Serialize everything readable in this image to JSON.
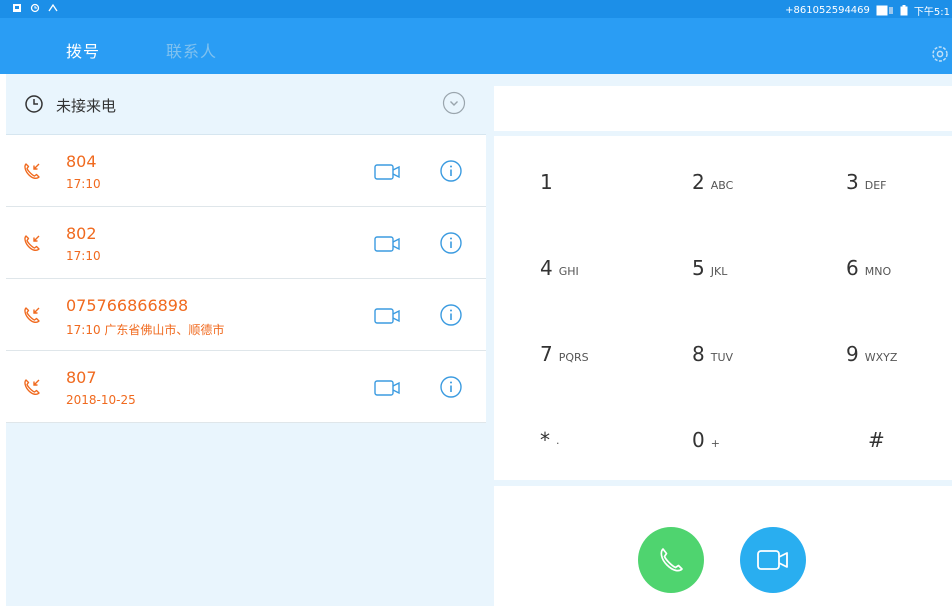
{
  "status_bar": {
    "phone_number": "+861052594469",
    "time": "下午5:1",
    "icons": [
      "sim-icon",
      "alarm-icon",
      "network-icon",
      "screen-icon",
      "battery-icon"
    ]
  },
  "tabs": {
    "dial": "拨号",
    "contacts": "联系人"
  },
  "call_log": {
    "section_title": "未接来电",
    "entries": [
      {
        "number": "804",
        "detail": "17:10"
      },
      {
        "number": "802",
        "detail": "17:10"
      },
      {
        "number": "075766866898",
        "detail": "17:10 广东省佛山市、顺德市"
      },
      {
        "number": "807",
        "detail": "2018-10-25"
      }
    ]
  },
  "dialpad": {
    "display_value": "",
    "keys": [
      {
        "digit": "1",
        "letters": ""
      },
      {
        "digit": "2",
        "letters": "ABC"
      },
      {
        "digit": "3",
        "letters": "DEF"
      },
      {
        "digit": "4",
        "letters": "GHI"
      },
      {
        "digit": "5",
        "letters": "JKL"
      },
      {
        "digit": "6",
        "letters": "MNO"
      },
      {
        "digit": "7",
        "letters": "PQRS"
      },
      {
        "digit": "8",
        "letters": "TUV"
      },
      {
        "digit": "9",
        "letters": "WXYZ"
      },
      {
        "digit": "*",
        "letters": "·"
      },
      {
        "digit": "0",
        "letters": "+"
      },
      {
        "digit": "#",
        "letters": ""
      }
    ]
  },
  "colors": {
    "status_bar": "#1c8fe8",
    "app_bar": "#2a9df4",
    "missed_call": "#f06a1f",
    "call_button": "#4fd46f",
    "video_button": "#29aef0",
    "pane_background": "#e9f5fd"
  }
}
